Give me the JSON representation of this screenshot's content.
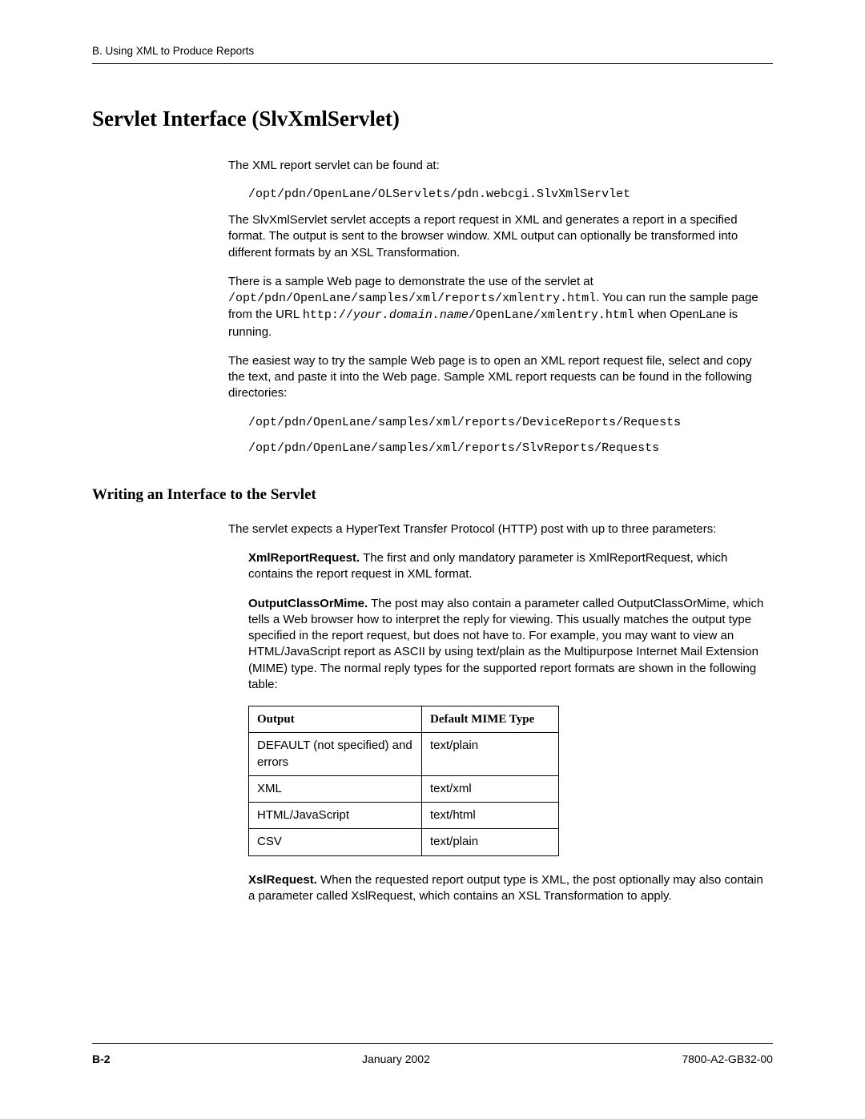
{
  "header": {
    "running": "B. Using XML to Produce Reports"
  },
  "section": {
    "title": "Servlet Interface (SlvXmlServlet)"
  },
  "body": {
    "p1": "The XML report servlet can be found at:",
    "path1": "/opt/pdn/OpenLane/OLServlets/pdn.webcgi.SlvXmlServlet",
    "p2": "The SlvXmlServlet servlet accepts a report request in XML and generates a report in a specified format. The output is sent to the browser window. XML output can optionally be transformed into different formats by an XSL Transformation.",
    "p3a": "There is a sample Web page to demonstrate the use of the servlet at",
    "p3path": "/opt/pdn/OpenLane/samples/xml/reports/xmlentry.html",
    "p3b": ". You can run the sample page from the URL",
    "p3url_pre": "http://",
    "p3url_mid": "your.domain.name",
    "p3url_post": "/OpenLane/xmlentry.html",
    "p3c": "when OpenLane is running.",
    "p4": "The easiest way to try the sample Web page is to open an XML report request file, select and copy the text, and paste it into the Web page. Sample XML report requests can be found in the following directories:",
    "path2": "/opt/pdn/OpenLane/samples/xml/reports/DeviceReports/Requests",
    "path3": "/opt/pdn/OpenLane/samples/xml/reports/SlvReports/Requests"
  },
  "subsection": {
    "title": "Writing an Interface to the Servlet",
    "intro": "The servlet expects a HyperText Transfer Protocol (HTTP) post with up to three parameters:",
    "param1_name": "XmlReportRequest.",
    "param1_text": " The first and only mandatory parameter is XmlReportRequest, which contains the report request in XML format.",
    "param2_name": "OutputClassOrMime.",
    "param2_text": " The post may also contain a parameter called OutputClassOrMime, which tells a Web browser how to interpret the reply for viewing. This usually matches the output type specified in the report request, but does not have to. For example, you may want to view an HTML/JavaScript report as ASCII by using text/plain as the Multipurpose Internet Mail Extension (MIME) type. The normal reply types for the supported report formats are shown in the following table:",
    "param3_name": "XslRequest.",
    "param3_text": " When the requested report output type is XML, the post optionally may also contain a parameter called XslRequest, which contains an XSL Transformation to apply."
  },
  "table": {
    "headers": [
      "Output",
      "Default MIME Type"
    ],
    "rows": [
      [
        "DEFAULT (not specified) and errors",
        "text/plain"
      ],
      [
        "XML",
        "text/xml"
      ],
      [
        "HTML/JavaScript",
        "text/html"
      ],
      [
        "CSV",
        "text/plain"
      ]
    ]
  },
  "footer": {
    "page": "B-2",
    "date": "January 2002",
    "docnum": "7800-A2-GB32-00"
  }
}
